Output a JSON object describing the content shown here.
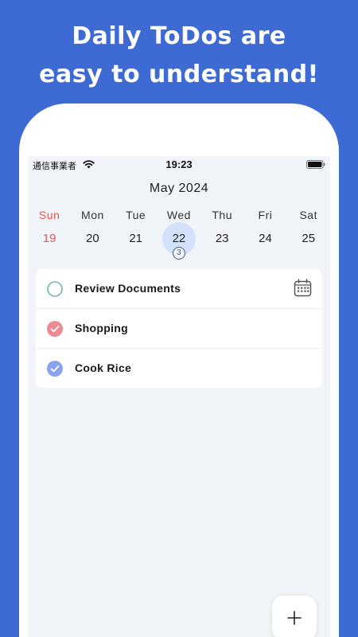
{
  "headline": {
    "line1": "Daily ToDos are",
    "line2": "easy to understand!"
  },
  "status_bar": {
    "carrier": "通信事業者",
    "time": "19:23",
    "icons": [
      "wifi-icon",
      "battery-icon"
    ]
  },
  "calendar": {
    "month_label": "May 2024",
    "days": [
      {
        "name": "Sun",
        "date": "19"
      },
      {
        "name": "Mon",
        "date": "20"
      },
      {
        "name": "Tue",
        "date": "21"
      },
      {
        "name": "Wed",
        "date": "22",
        "selected": true,
        "badge": "3"
      },
      {
        "name": "Thu",
        "date": "23"
      },
      {
        "name": "Fri",
        "date": "24"
      },
      {
        "name": "Sat",
        "date": "25"
      }
    ]
  },
  "todos": [
    {
      "label": "Review Documents",
      "status": "open",
      "color": "#6fb8b3",
      "icon": "calendar-icon"
    },
    {
      "label": "Shopping",
      "status": "done",
      "color": "#ef8a91"
    },
    {
      "label": "Cook Rice",
      "status": "done",
      "color": "#8aa2ee"
    }
  ],
  "fab": {
    "label": "+",
    "icon": "plus-icon"
  },
  "colors": {
    "background": "#3e6ad3",
    "screen": "#f1f4f9",
    "selected_day": "#d3e1fb",
    "sunday": "#e05a55"
  }
}
